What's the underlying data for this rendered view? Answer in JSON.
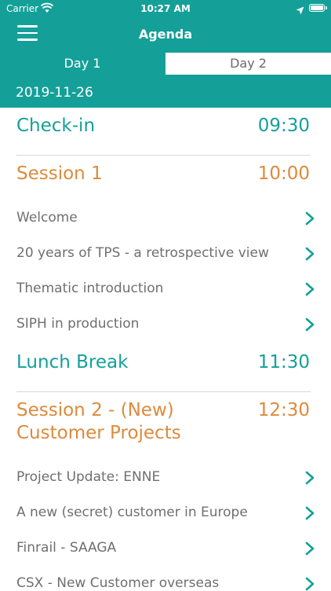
{
  "status_bar": {
    "carrier": "Carrier",
    "time": "10:27 AM"
  },
  "header": {
    "title": "Agenda"
  },
  "tabs": [
    {
      "label": "Day 1",
      "selected": true
    },
    {
      "label": "Day 2",
      "selected": false
    }
  ],
  "date": "2019-11-26",
  "agenda": {
    "checkin": {
      "title": "Check-in",
      "time": "09:30"
    },
    "session1": {
      "title": "Session 1",
      "time": "10:00",
      "items": [
        "Welcome",
        "20 years of TPS - a retrospective view",
        "Thematic introduction",
        "SIPH in production"
      ]
    },
    "lunch": {
      "title": "Lunch Break",
      "time": "11:30"
    },
    "session2": {
      "title_line1": "Session 2 - (New)",
      "title_line2": "Customer Projects",
      "time": "12:30",
      "items": [
        "Project Update: ENNE",
        "A new (secret) customer in Europe",
        "Finrail - SAAGA",
        "CSX - New Customer overseas"
      ]
    }
  },
  "colors": {
    "accent": "#14a099",
    "session": "#de8a3c",
    "item_text": "#6f6f6f"
  },
  "icons": {
    "menu": "hamburger-menu-icon",
    "disclosure": "chevron-right-icon",
    "wifi": "wifi-icon",
    "location": "location-arrow-icon",
    "battery": "battery-icon"
  }
}
